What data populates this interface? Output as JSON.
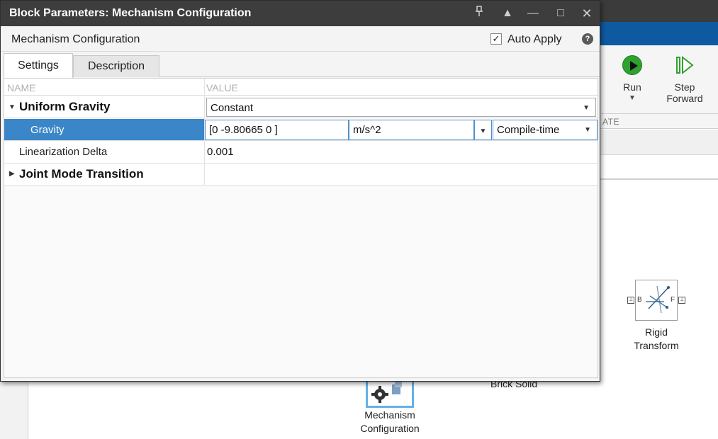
{
  "background": {
    "ribbon": {
      "run_label": "Run",
      "step_forward_label_line1": "Step",
      "step_forward_label_line2": "Forward",
      "section_label": "ATE"
    },
    "canvas": {
      "rigid_transform": {
        "label_line1": "Rigid",
        "label_line2": "Transform",
        "port_b": "B",
        "port_f": "F"
      },
      "mechanism_configuration": {
        "label_line1": "Mechanism",
        "label_line2": "Configuration"
      },
      "brick_solid_label": "Brick Solid"
    }
  },
  "dialog": {
    "title": "Block Parameters: Mechanism Configuration",
    "window_controls": {
      "pin": "□",
      "up": "▲",
      "minimize": "—",
      "maximize": "□",
      "close": "✕"
    },
    "subtitle": "Mechanism Configuration",
    "auto_apply": {
      "label": "Auto Apply",
      "checked": true,
      "check_glyph": "✓"
    },
    "help_glyph": "?",
    "tabs": [
      {
        "label": "Settings",
        "active": true
      },
      {
        "label": "Description",
        "active": false
      }
    ],
    "table": {
      "headers": {
        "name": "NAME",
        "value": "VALUE"
      },
      "rows": {
        "uniform_gravity": {
          "name": "Uniform Gravity",
          "value": "Constant",
          "expanded": true
        },
        "gravity": {
          "name": "Gravity",
          "value": "[0 -9.80665 0 ]",
          "units": "m/s^2",
          "evaluation": "Compile-time",
          "selected": true
        },
        "linearization_delta": {
          "name": "Linearization Delta",
          "value": "0.001"
        },
        "joint_mode_transition": {
          "name": "Joint Mode Transition",
          "expanded": false
        }
      }
    }
  }
}
